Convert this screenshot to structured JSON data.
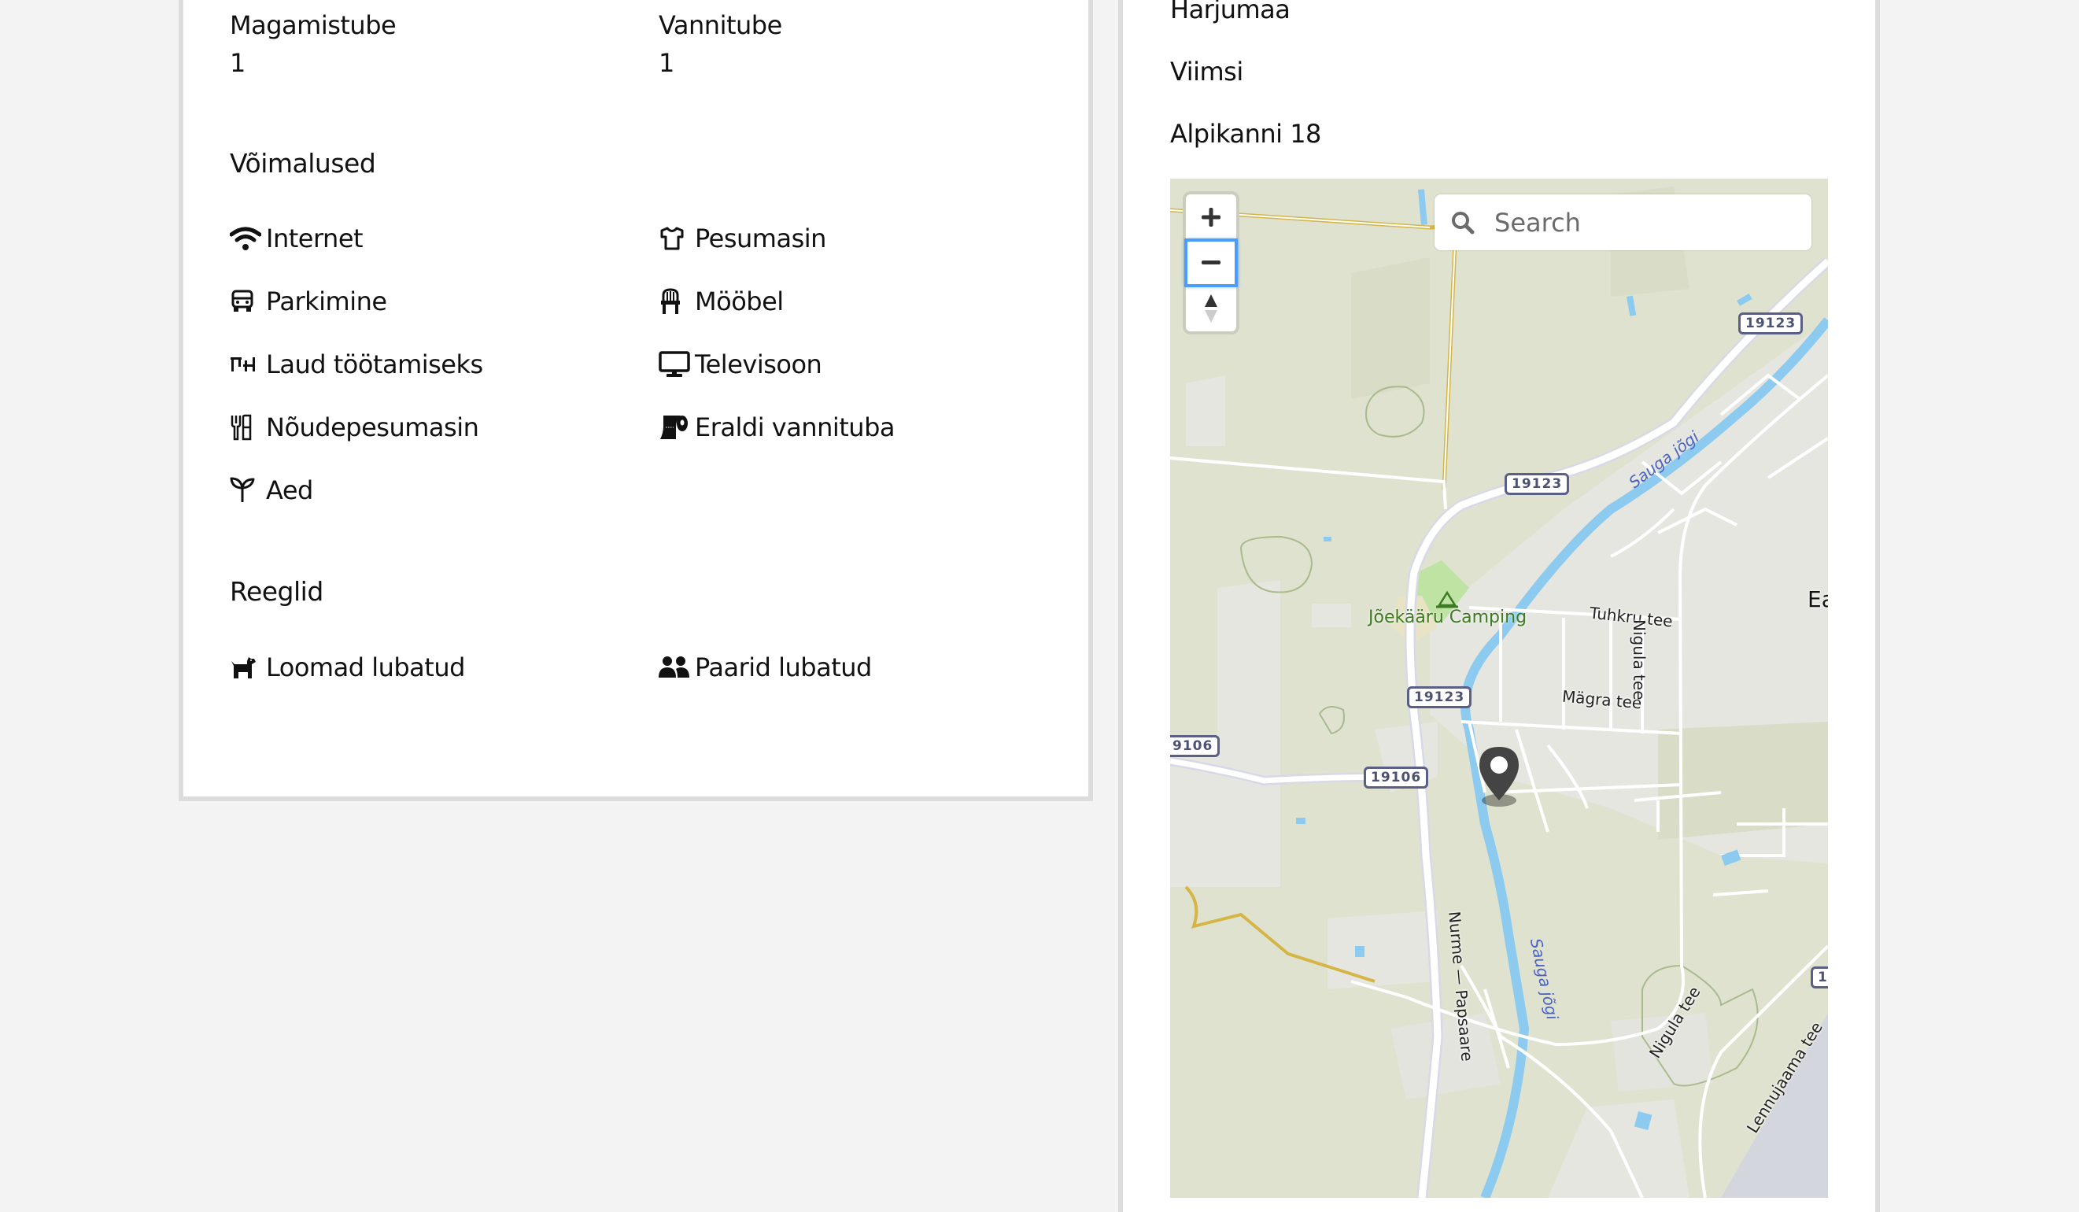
{
  "details": {
    "bedrooms": {
      "label": "Magamistube",
      "value": "1"
    },
    "bathrooms": {
      "label": "Vannitube",
      "value": "1"
    }
  },
  "amenities": {
    "title": "Võimalused",
    "items": [
      {
        "label": "Internet",
        "icon": "wifi-icon"
      },
      {
        "label": "Pesumasin",
        "icon": "shirt-icon"
      },
      {
        "label": "Parkimine",
        "icon": "car-icon"
      },
      {
        "label": "Mööbel",
        "icon": "chair-icon"
      },
      {
        "label": "Laud töötamiseks",
        "icon": "desk-icon"
      },
      {
        "label": "Televisoon",
        "icon": "tv-icon"
      },
      {
        "label": "Nõudepesumasin",
        "icon": "utensils-icon"
      },
      {
        "label": "Eraldi vannituba",
        "icon": "toilet-paper-icon"
      },
      {
        "label": "Aed",
        "icon": "seedling-icon"
      }
    ]
  },
  "rules": {
    "title": "Reeglid",
    "items": [
      {
        "label": "Loomad lubatud",
        "icon": "dog-icon"
      },
      {
        "label": "Paarid lubatud",
        "icon": "users-icon"
      }
    ]
  },
  "location": {
    "county": "Harjumaa",
    "municipality": "Viimsi",
    "address": "Alpikanni 18"
  },
  "map": {
    "zoom_in": "+",
    "zoom_out": "−",
    "search_placeholder": "Search",
    "labels": {
      "poi": "Jõekääru Camping",
      "river1": "Sauga jõgi",
      "river2": "Sauga jõgi",
      "street_tuhkru": "Tuhkru tee",
      "street_magra": "Mägra tee",
      "street_nigula1": "Nigula tee",
      "street_nigula2": "Nigula tee",
      "street_nurme": "Nurme — Papsaare",
      "street_lennujaama": "Lennujaama tee",
      "place_partial": "Ea",
      "shield_19123_a": "19123",
      "shield_19123_b": "19123",
      "shield_19123_c": "19123",
      "shield_19106_a": "9106",
      "shield_19106_b": "19106",
      "shield_edge": "1"
    },
    "colors": {
      "land": "#dfe2cf",
      "urban": "#e6e6e1",
      "water": "#8ccbef",
      "road": "#ffffff",
      "track": "#d4b545",
      "park": "#bfe3a3",
      "marker": "#444444"
    }
  }
}
